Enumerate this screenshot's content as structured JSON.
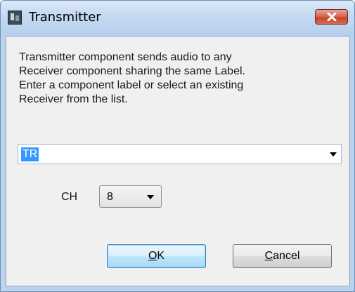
{
  "window": {
    "title": "Transmitter",
    "icon": "app-icon",
    "close_icon": "close-icon"
  },
  "description": {
    "lines": [
      "Transmitter component sends audio to any",
      "Receiver component sharing the same Label.",
      "Enter a component label or select an existing",
      "Receiver from the list."
    ]
  },
  "label_combo": {
    "value": "TR",
    "arrow_icon": "chevron-down-icon"
  },
  "channel": {
    "label": "CH",
    "value": "8",
    "arrow_icon": "chevron-down-icon"
  },
  "buttons": {
    "ok": {
      "mnemonic": "O",
      "rest": "K"
    },
    "cancel": {
      "mnemonic": "C",
      "rest": "ancel"
    }
  },
  "colors": {
    "selection": "#3399ff",
    "close_button": "#c7432c",
    "title_bar": "#bcd3ee"
  }
}
